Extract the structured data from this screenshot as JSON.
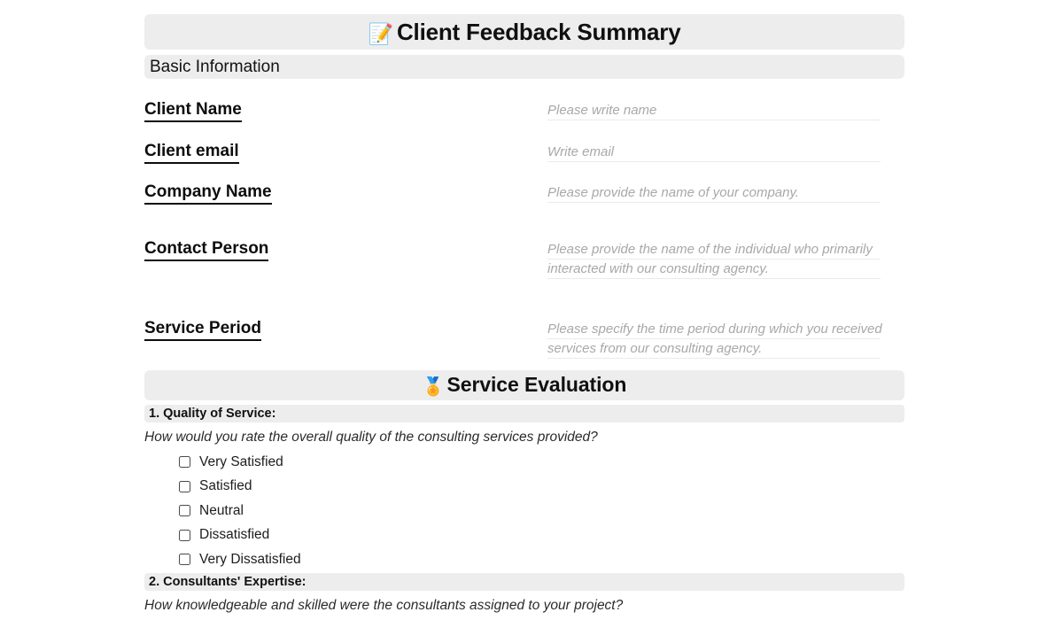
{
  "document": {
    "title": "Client Feedback Summary",
    "title_emoji": "📝"
  },
  "basic_information": {
    "section_title": "Basic Information",
    "fields": [
      {
        "label": "Client Name",
        "hint_lines": [
          "Please write name"
        ]
      },
      {
        "label": "Client email",
        "hint_lines": [
          "Write email"
        ]
      },
      {
        "label": "Company Name",
        "hint_lines": [
          "Please provide the name of your company."
        ]
      },
      {
        "label": "Contact Person",
        "hint_lines": [
          "Please provide the name of the individual who primarily",
          "interacted with our consulting agency."
        ]
      },
      {
        "label": "Service Period",
        "hint_lines": [
          "Please specify the time period during which you received",
          "services from our consulting agency."
        ]
      }
    ]
  },
  "service_evaluation": {
    "section_title": "Service Evaluation",
    "section_emoji": "🏅",
    "questions": [
      {
        "heading": "1. Quality of Service:",
        "prompt": "How would you rate the overall quality of the consulting services provided?",
        "options": [
          "Very Satisfied",
          "Satisfied",
          "Neutral",
          "Dissatisfied",
          "Very Dissatisfied"
        ]
      },
      {
        "heading": "2. Consultants' Expertise:",
        "prompt": "How knowledgeable and skilled were the consultants assigned to your project?",
        "options": []
      }
    ]
  },
  "colors": {
    "bar_background": "#ededed",
    "hint_text": "#a8a8a8",
    "body_text": "#1a1a1a"
  }
}
